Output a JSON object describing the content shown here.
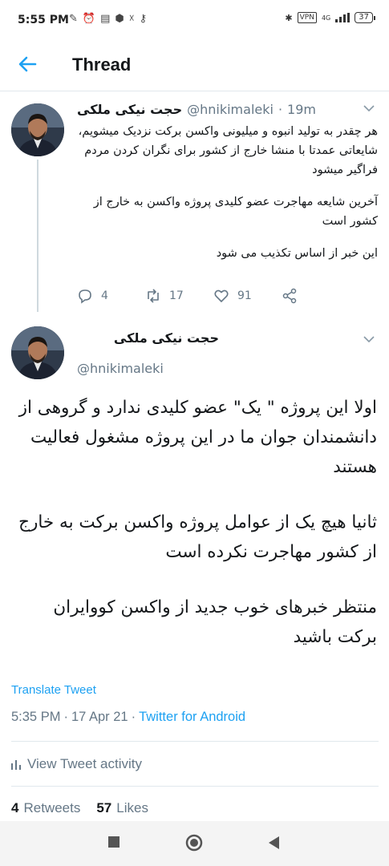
{
  "status_bar": {
    "time": "5:55 PM",
    "vpn": "VPN",
    "network": "4G",
    "battery": "37"
  },
  "header": {
    "title": "Thread"
  },
  "parent_tweet": {
    "name": "حجت نیکی ملکی",
    "handle": "@hnikimaleki",
    "dot": "·",
    "time": "19m",
    "paragraphs": [
      "هر چقدر به تولید انبوه و میلیونی واکسن برکت نزدیک میشویم، شایعاتی عمدتا با منشا خارج از کشور برای نگران کردن مردم فراگیر میشود",
      "آخرین شایعه مهاجرت عضو کلیدی پروژه واکسن به خارج از کشور است",
      "این خبر از اساس تکذیب می شود"
    ],
    "replies": "4",
    "retweets": "17",
    "likes": "91"
  },
  "main_tweet": {
    "name": "حجت نیکی ملکی",
    "handle": "@hnikimaleki",
    "paragraphs": [
      "اولا این پروژه \" یک\" عضو کلیدی ندارد و گروهی از دانشمندان جوان ما در این پروژه مشغول فعالیت هستند",
      "ثانیا هیچ یک از عوامل پروژه واکسن برکت به خارج از کشور مهاجرت نکرده است",
      "منتظر خبرهای خوب جدید از واکسن کووایران برکت باشید"
    ],
    "translate_label": "Translate Tweet",
    "time": "5:35 PM",
    "date": "17 Apr 21",
    "sep": "·",
    "source": "Twitter for Android",
    "activity_label": "View Tweet activity",
    "retweet_count": "4",
    "retweet_label": "Retweets",
    "like_count": "57",
    "like_label": "Likes"
  },
  "colors": {
    "accent": "#1da1f2",
    "secondary_text": "#657786",
    "divider": "#e1e8ed"
  }
}
